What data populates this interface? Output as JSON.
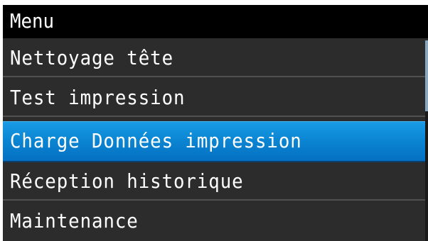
{
  "header": {
    "title": "Menu"
  },
  "menu": {
    "items": [
      {
        "label": "Nettoyage tête",
        "selected": false
      },
      {
        "label": "Test impression",
        "selected": false
      },
      {
        "label": "Charge Données impression",
        "selected": true
      },
      {
        "label": "Réception historique",
        "selected": false
      },
      {
        "label": "Maintenance",
        "selected": false
      }
    ]
  },
  "colors": {
    "background": "#2c2c2c",
    "title_bar": "#000000",
    "selection": "#0b86d3",
    "text": "#ffffff"
  }
}
